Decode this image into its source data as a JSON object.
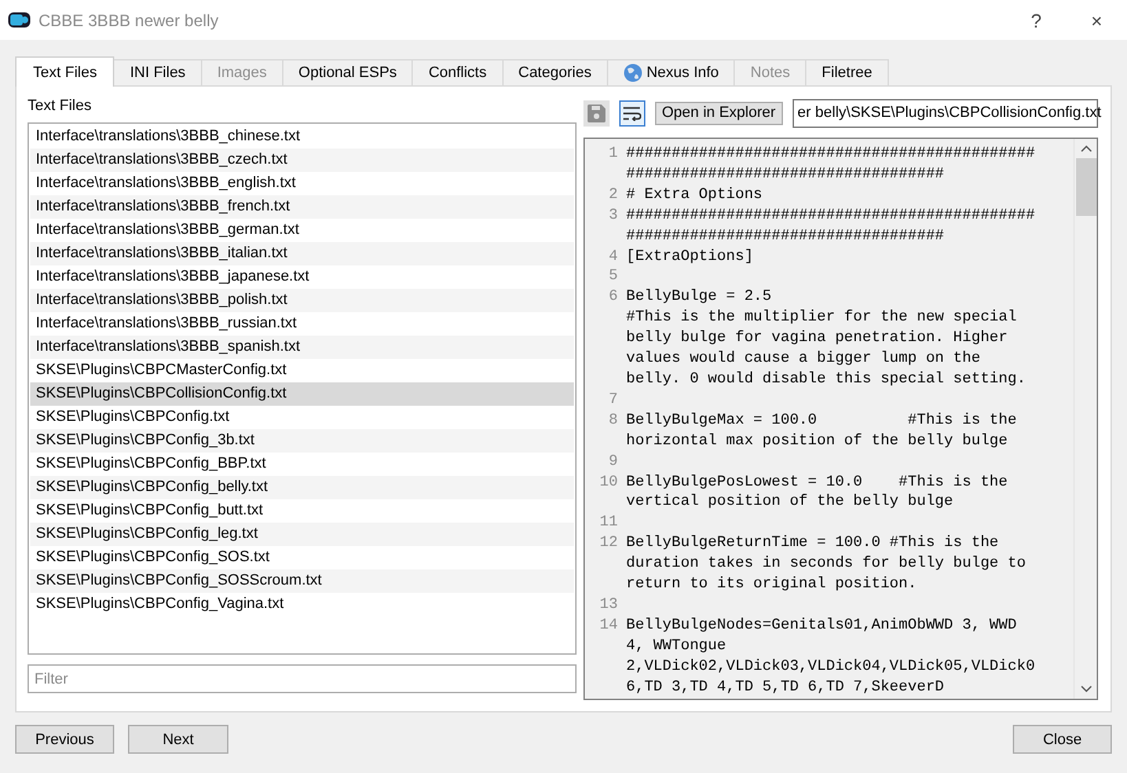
{
  "window": {
    "title": "CBBE 3BBB newer belly",
    "help": "?",
    "close": "×"
  },
  "tabs": [
    {
      "label": "Text Files",
      "selected": true,
      "disabled": false,
      "kind": "plain"
    },
    {
      "label": "INI Files",
      "selected": false,
      "disabled": false,
      "kind": "plain"
    },
    {
      "label": "Images",
      "selected": false,
      "disabled": true,
      "kind": "plain"
    },
    {
      "label": "Optional ESPs",
      "selected": false,
      "disabled": false,
      "kind": "plain"
    },
    {
      "label": "Conflicts",
      "selected": false,
      "disabled": false,
      "kind": "plain"
    },
    {
      "label": "Categories",
      "selected": false,
      "disabled": false,
      "kind": "plain"
    },
    {
      "label": "Nexus Info",
      "selected": false,
      "disabled": false,
      "kind": "globe"
    },
    {
      "label": "Notes",
      "selected": false,
      "disabled": true,
      "kind": "plain"
    },
    {
      "label": "Filetree",
      "selected": false,
      "disabled": false,
      "kind": "plain"
    }
  ],
  "file_list": {
    "label": "Text Files",
    "items": [
      {
        "name": "Interface\\translations\\3BBB_chinese.txt",
        "selected": false
      },
      {
        "name": "Interface\\translations\\3BBB_czech.txt",
        "selected": false
      },
      {
        "name": "Interface\\translations\\3BBB_english.txt",
        "selected": false
      },
      {
        "name": "Interface\\translations\\3BBB_french.txt",
        "selected": false
      },
      {
        "name": "Interface\\translations\\3BBB_german.txt",
        "selected": false
      },
      {
        "name": "Interface\\translations\\3BBB_italian.txt",
        "selected": false
      },
      {
        "name": "Interface\\translations\\3BBB_japanese.txt",
        "selected": false
      },
      {
        "name": "Interface\\translations\\3BBB_polish.txt",
        "selected": false
      },
      {
        "name": "Interface\\translations\\3BBB_russian.txt",
        "selected": false
      },
      {
        "name": "Interface\\translations\\3BBB_spanish.txt",
        "selected": false
      },
      {
        "name": "SKSE\\Plugins\\CBPCMasterConfig.txt",
        "selected": false
      },
      {
        "name": "SKSE\\Plugins\\CBPCollisionConfig.txt",
        "selected": true
      },
      {
        "name": "SKSE\\Plugins\\CBPConfig.txt",
        "selected": false
      },
      {
        "name": "SKSE\\Plugins\\CBPConfig_3b.txt",
        "selected": false
      },
      {
        "name": "SKSE\\Plugins\\CBPConfig_BBP.txt",
        "selected": false
      },
      {
        "name": "SKSE\\Plugins\\CBPConfig_belly.txt",
        "selected": false
      },
      {
        "name": "SKSE\\Plugins\\CBPConfig_butt.txt",
        "selected": false
      },
      {
        "name": "SKSE\\Plugins\\CBPConfig_leg.txt",
        "selected": false
      },
      {
        "name": "SKSE\\Plugins\\CBPConfig_SOS.txt",
        "selected": false
      },
      {
        "name": "SKSE\\Plugins\\CBPConfig_SOSScroum.txt",
        "selected": false
      },
      {
        "name": "SKSE\\Plugins\\CBPConfig_Vagina.txt",
        "selected": false
      }
    ],
    "filter": {
      "placeholder": "Filter"
    }
  },
  "editor": {
    "save_disabled": true,
    "wrap_on": true,
    "open_button": "Open in Explorer",
    "path": "er belly\\SKSE\\Plugins\\CBPCollisionConfig.txt",
    "lines": [
      {
        "number": "1",
        "text": "################################################################################"
      },
      {
        "number": "2",
        "text": "# Extra Options"
      },
      {
        "number": "3",
        "text": "################################################################################"
      },
      {
        "number": "4",
        "text": "[ExtraOptions]"
      },
      {
        "number": "5"
      },
      {
        "number": "6",
        "text": "BellyBulge = 2.5                             #This is the multiplier for the new special belly bulge for vagina penetration. Higher values would cause a bigger lump on the belly. 0 would disable this special setting."
      },
      {
        "number": "7"
      },
      {
        "number": "8",
        "text": "BellyBulgeMax = 100.0          #This is the horizontal max position of the belly bulge"
      },
      {
        "number": "9"
      },
      {
        "number": "10",
        "text": "BellyBulgePosLowest = 10.0    #This is the vertical position of the belly bulge"
      },
      {
        "number": "11"
      },
      {
        "number": "12",
        "text": "BellyBulgeReturnTime = 100.0 #This is the duration takes in seconds for belly bulge to return to its original position."
      },
      {
        "number": "13"
      },
      {
        "number": "14",
        "text": "BellyBulgeNodes=Genitals01,AnimObWWD 3, WWD 4, WWTongue 2,VLDick02,VLDick03,VLDick04,VLDick05,VLDick06,TD 3,TD 4,TD 5,TD 6,TD 7,SkeeverD"
      }
    ]
  },
  "buttons": [
    {
      "label": "Previous",
      "kind": "left"
    },
    {
      "label": "Next",
      "kind": "left"
    },
    {
      "label": "Close",
      "kind": "right"
    }
  ]
}
